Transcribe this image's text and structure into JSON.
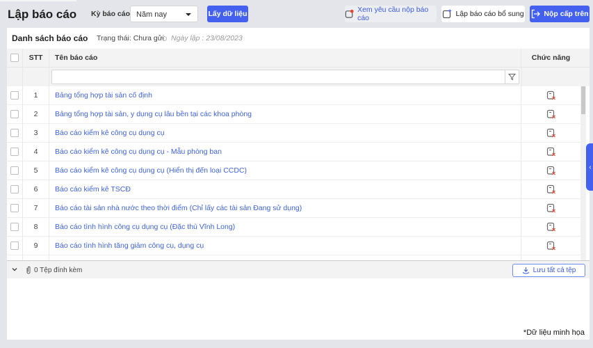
{
  "header": {
    "title": "Lập báo cáo",
    "period_label": "Kỳ báo cáo",
    "period_value": "Năm nay",
    "get_data_label": "Lấy dữ liệu",
    "view_requests_label": "Xem yêu cầu nộp báo cáo",
    "add_report_label": "Lập báo cáo bổ sung",
    "submit_label": "Nộp cấp trên"
  },
  "panel": {
    "title": "Danh sách báo cáo",
    "status": "Trạng thái: Chưa gửi",
    "date": "Ngày lập : 23/08/2023"
  },
  "table": {
    "columns": {
      "stt": "STT",
      "name": "Tên báo cáo",
      "function": "Chức năng"
    },
    "filter_value": "",
    "rows": [
      {
        "stt": "1",
        "name": "Bảng tổng hợp tài sản cố định"
      },
      {
        "stt": "2",
        "name": "Bảng tổng hợp tài sản, y dụng cụ lâu bền tại các khoa phòng"
      },
      {
        "stt": "3",
        "name": "Báo cáo kiểm kê công cụ dụng cụ"
      },
      {
        "stt": "4",
        "name": "Báo cáo kiểm kê công cụ dụng cụ - Mẫu phòng ban"
      },
      {
        "stt": "5",
        "name": "Báo cáo kiểm kê công cụ dụng cụ (Hiển thị đến loại CCDC)"
      },
      {
        "stt": "6",
        "name": "Báo cáo kiểm kê TSCĐ"
      },
      {
        "stt": "7",
        "name": "Báo cáo tài sản nhà nước theo thời điểm (Chỉ lấy các tài sản Đang sử dụng)"
      },
      {
        "stt": "8",
        "name": "Báo cáo tình hình công cụ dụng cụ (Đặc thù Vĩnh Long)"
      },
      {
        "stt": "9",
        "name": "Báo cáo tình hình tăng giảm công cụ, dụng cụ"
      }
    ]
  },
  "footer": {
    "attachments": "0 Tệp đính kèm",
    "save_all_label": "Lưu tất cả tệp"
  },
  "note": "*Dữ liệu minh họa",
  "colors": {
    "accent": "#4361ee",
    "link": "#3f63d9"
  }
}
